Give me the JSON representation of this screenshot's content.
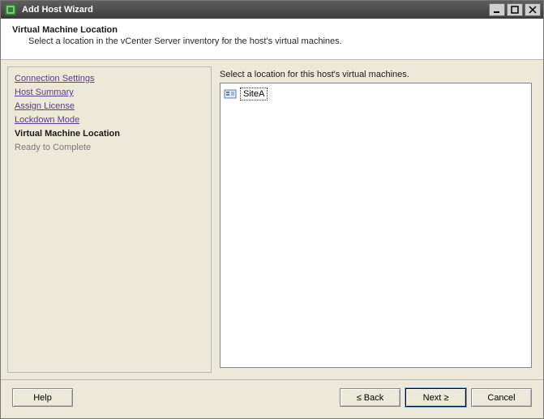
{
  "window": {
    "title": "Add Host Wizard"
  },
  "header": {
    "title": "Virtual Machine Location",
    "subtitle": "Select a location in the vCenter Server inventory for the host's virtual machines."
  },
  "sidebar": {
    "steps": [
      {
        "label": "Connection Settings",
        "state": "link"
      },
      {
        "label": "Host Summary",
        "state": "link"
      },
      {
        "label": "Assign License",
        "state": "link"
      },
      {
        "label": "Lockdown Mode",
        "state": "link"
      },
      {
        "label": "Virtual Machine Location",
        "state": "current"
      },
      {
        "label": "Ready to Complete",
        "state": "pending"
      }
    ]
  },
  "main": {
    "prompt": "Select a location for this host's virtual machines.",
    "tree": [
      {
        "label": "SiteA",
        "selected": true
      }
    ]
  },
  "footer": {
    "help": "Help",
    "back": "≤ Back",
    "next": "Next ≥",
    "cancel": "Cancel"
  }
}
